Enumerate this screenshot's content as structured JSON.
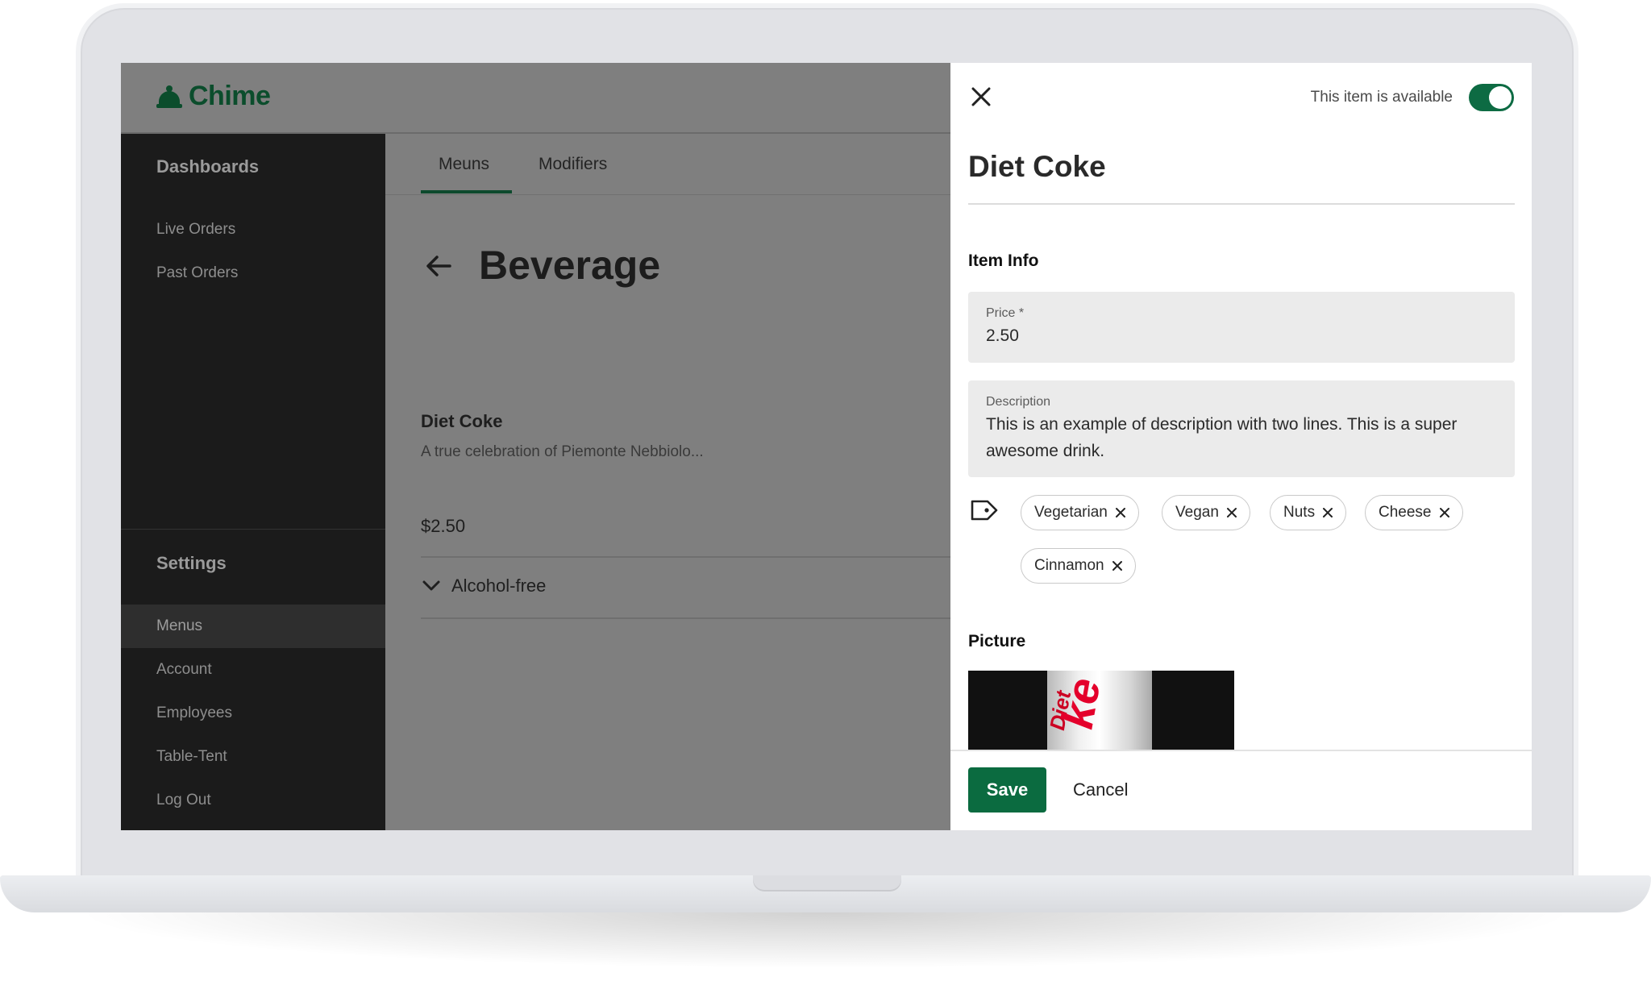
{
  "app": {
    "logo_text": "Chime",
    "brand_color": "#0b4d2c",
    "accent_color": "#0b6b40"
  },
  "sidebar": {
    "sections": [
      {
        "title": "Dashboards",
        "items": [
          {
            "label": "Live Orders"
          },
          {
            "label": "Past Orders"
          }
        ]
      },
      {
        "title": "Settings",
        "items": [
          {
            "label": "Menus",
            "active": true
          },
          {
            "label": "Account"
          },
          {
            "label": "Employees"
          },
          {
            "label": "Table-Tent"
          },
          {
            "label": "Log Out"
          }
        ]
      }
    ]
  },
  "main": {
    "tabs": [
      {
        "label": "Meuns",
        "active": true
      },
      {
        "label": "Modifiers"
      }
    ],
    "page_title": "Beverage",
    "item": {
      "name": "Diet Coke",
      "description": "A true celebration of Piemonte Nebbiolo...",
      "price": "$2.50",
      "category": "Alcohol-free"
    }
  },
  "drawer": {
    "availability_label": "This item is available",
    "available": true,
    "title": "Diet Coke",
    "item_info_heading": "Item Info",
    "price": {
      "label": "Price *",
      "value": "2.50"
    },
    "description": {
      "label": "Description",
      "value": "This is an example of description with two lines. This is a super awesome drink."
    },
    "tags": [
      {
        "label": "Vegetarian"
      },
      {
        "label": "Vegan"
      },
      {
        "label": "Nuts"
      },
      {
        "label": "Cheese"
      },
      {
        "label": "Cinnamon"
      }
    ],
    "picture_heading": "Picture",
    "save_label": "Save",
    "cancel_label": "Cancel"
  },
  "icons": {
    "logo": "bell-icon",
    "close": "close-icon",
    "back": "arrow-left-icon",
    "expand": "chevron-down-icon",
    "tag": "tag-icon",
    "chip_remove": "close-icon"
  }
}
